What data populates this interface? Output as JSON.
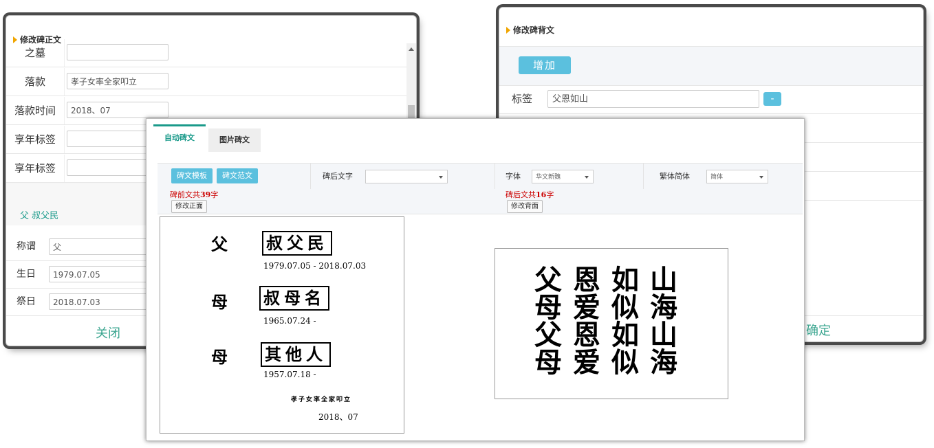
{
  "front_dialog": {
    "title": "修改碑正文",
    "rows": [
      {
        "label": "之墓",
        "value": ""
      },
      {
        "label": "落款",
        "value": "孝子女率全家叩立"
      },
      {
        "label": "落款时间",
        "value": "2018、07"
      },
      {
        "label": "享年标签",
        "value": ""
      },
      {
        "label": "享年标签",
        "value": ""
      }
    ],
    "person_label": "父 叔父民",
    "person_rows": [
      {
        "label": "称谓",
        "value": "父"
      },
      {
        "label": "生日",
        "value": "1979.07.05"
      },
      {
        "label": "祭日",
        "value": "2018.07.03"
      }
    ],
    "close_label": "关闭"
  },
  "back_dialog": {
    "title": "修改碑背文",
    "add_label": "增加",
    "tag_label": "标签",
    "tag_value": "父恩如山",
    "minus_label": "-",
    "confirm_label": "确定"
  },
  "main": {
    "tabs": [
      {
        "label": "自动碑文"
      },
      {
        "label": "图片碑文"
      }
    ],
    "toolbar": {
      "template_btn": "碑文模板",
      "sample_btn": "碑文范文",
      "back_text_label": "碑后文字",
      "back_text_value": "",
      "font_label": "字体",
      "font_value": "华文新魏",
      "script_label": "繁体简体",
      "script_value": "简体"
    },
    "front_count": {
      "prefix": "碑前文共",
      "num": "39",
      "suffix": "字"
    },
    "back_count": {
      "prefix": "碑后文共",
      "num": "16",
      "suffix": "字"
    },
    "edit_front": "修改正面",
    "edit_back": "修改背面",
    "front_preview": {
      "persons": [
        {
          "relation": "父",
          "name": "叔父民",
          "dates": "1979.07.05  -   2018.07.03"
        },
        {
          "relation": "母",
          "name": "叔母名",
          "dates": "1965.07.24  -"
        },
        {
          "relation": "母",
          "name": "其他人",
          "dates": "1957.07.18  -"
        }
      ],
      "signature": "孝子女率全家叩立",
      "sign_date": "2018、07"
    },
    "back_preview": {
      "lines": [
        "父恩如山",
        "母爱似海",
        "父恩如山",
        "母爱似海"
      ]
    }
  }
}
